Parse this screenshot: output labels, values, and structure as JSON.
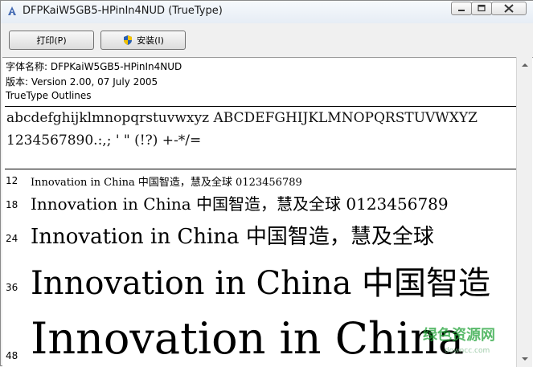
{
  "window": {
    "title": "DFPKaiW5GB5-HPinIn4NUD (TrueType)",
    "controls": [
      "minimize-icon",
      "maximize-icon",
      "close-icon"
    ]
  },
  "toolbar": {
    "print_label": "打印(P)",
    "install_label": "安装(I)"
  },
  "info": {
    "font_name": "字体名称: DFPKaiW5GB5-HPinIn4NUD",
    "version": "版本: Version 2.00, 07 July 2005",
    "type": "TrueType Outlines"
  },
  "charset": {
    "line1": "abcdefghijklmnopqrstuvwxyz ABCDEFGHIJKLMNOPQRSTUVWXYZ",
    "line2": "1234567890.:,; ' \" (!?) +-*/="
  },
  "samples": [
    {
      "size": "12",
      "text": "Innovation in China 中国智造，慧及全球 0123456789"
    },
    {
      "size": "18",
      "text": "Innovation in China 中国智造，慧及全球 0123456789"
    },
    {
      "size": "24",
      "text": "Innovation in China 中国智造，慧及全球"
    },
    {
      "size": "36",
      "text": "Innovation in China 中国智造"
    },
    {
      "size": "48",
      "text": "Innovation in China"
    }
  ],
  "watermark": {
    "text": "绿色资源网",
    "url": "downcc.com"
  },
  "colors": {
    "accent": "#24a43a",
    "shield_blue": "#2a5fb0",
    "shield_yellow": "#f2c200"
  }
}
